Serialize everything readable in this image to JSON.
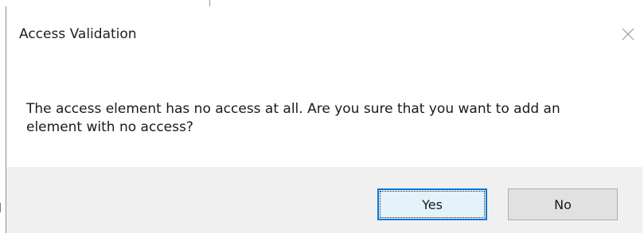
{
  "dialog": {
    "title": "Access Validation",
    "message": "The access element has no access at all. Are you sure that you want to add an element with no access?",
    "buttons": {
      "yes_label": "Yes",
      "no_label": "No"
    },
    "close_icon": "close-icon",
    "accent_color": "#0078d7",
    "footer_color": "#f0f0f0"
  }
}
